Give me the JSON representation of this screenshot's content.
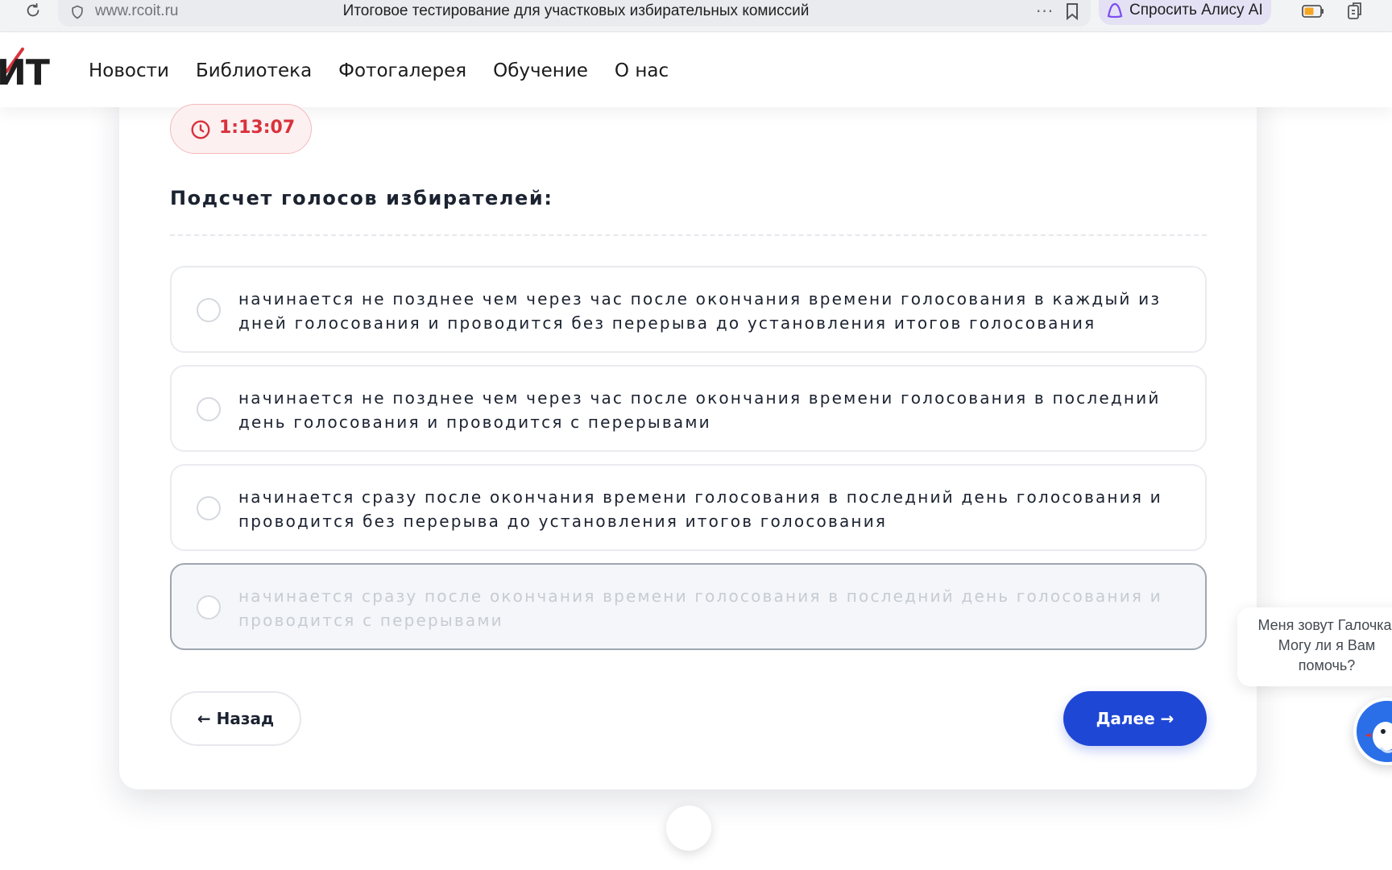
{
  "browser": {
    "url": "www.rcoit.ru",
    "tab_title": "Итоговое тестирование для участковых избирательных комиссий",
    "more_label": "···",
    "alice_label": "Спросить Алису AI"
  },
  "site": {
    "logo_text": "ИТ",
    "nav": [
      "Новости",
      "Библиотека",
      "Фотогалерея",
      "Обучение",
      "О нас"
    ]
  },
  "quiz": {
    "timer": "1:13:07",
    "question": "Подсчет голосов избирателей:",
    "options": [
      {
        "text": "начинается не позднее чем через час после окончания времени голосования в каждый из дней голосования и проводится без перерыва до установления итогов голосования",
        "selected": false
      },
      {
        "text": "начинается не позднее чем через час после окончания времени голосования в последний день голосования и проводится с перерывами",
        "selected": false
      },
      {
        "text": "начинается сразу после окончания времени голосования в последний день голосования и проводится без перерыва до установления итогов голосования",
        "selected": false
      },
      {
        "text": "начинается сразу после окончания времени голосования в последний день голосования и проводится с перерывами",
        "selected": true
      }
    ],
    "back_label": "← Назад",
    "next_label": "Далее →"
  },
  "chat": {
    "lines": [
      "Меня зовут Галочка.",
      "Могу ли я Вам",
      "помочь?"
    ]
  },
  "colors": {
    "accent": "#1f47d6",
    "timer": "#d8323c",
    "logo_tick": "#d8323c"
  }
}
